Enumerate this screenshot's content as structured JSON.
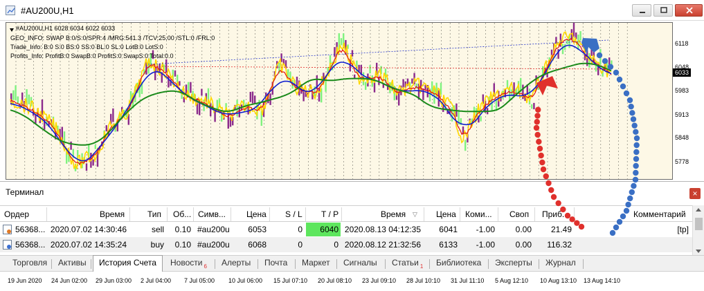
{
  "window": {
    "title": "#AU200U,H1"
  },
  "chart": {
    "info_lines": [
      "#AU200U,H1  6028 6034 6022 6033",
      "GEO_INFO: SWAP B:0/S:0/SPR:4 /MRG:541.3 /TCV:25.00 /STL:0 /FRL:0",
      "Trade_Info: B:0 S:0 BS:0 SS:0 BL:0 SL:0 LotB:0 LotS:0",
      "Profits_Info: ProfitB:0 SwapB:0 ProfitS:0 SwapS:0 Total:0.0"
    ],
    "current_price": "6033",
    "y_ticks": [
      "6118",
      "6048",
      "5983",
      "5913",
      "5848",
      "5778"
    ],
    "x_ticks": [
      "19 Jun 2020",
      "24 Jun 02:00",
      "29 Jun 03:00",
      "2 Jul 04:00",
      "7 Jul 05:00",
      "10 Jul 06:00",
      "15 Jul 07:10",
      "20 Jul 08:10",
      "23 Jul 09:10",
      "28 Jul 10:10",
      "31 Jul 11:10",
      "5 Aug 12:10",
      "10 Aug 13:10",
      "13 Aug 14:10"
    ],
    "colors": {
      "background": "#fdf8e6",
      "price": "#ffd800",
      "ma_fast": "#e01010",
      "ma_mid": "#1020d0",
      "ma_slow": "#1a8a1a",
      "bull_bar": "#7ff27f",
      "bear_bar": "#8b2a8b",
      "annotation_red": "#e0302c",
      "annotation_blue": "#3a6fc4"
    }
  },
  "terminal": {
    "title": "Терминал",
    "close_label": "×",
    "columns": [
      "Ордер",
      "Время",
      "Тип",
      "Об...",
      "Симв...",
      "Цена",
      "S / L",
      "T / P",
      "Время",
      "Цена",
      "Коми...",
      "Своп",
      "Приб...",
      "Комментарий"
    ],
    "rows": [
      {
        "order": "56368...",
        "open_time": "2020.07.02 14:30:46",
        "type": "sell",
        "volume": "0.10",
        "symbol": "#au200u",
        "open_price": "6053",
        "sl": "0",
        "tp": "6040",
        "close_time": "2020.08.13 04:12:35",
        "close_price": "6041",
        "commission": "-1.00",
        "swap": "0.00",
        "profit": "21.49",
        "comment": "[tp]"
      },
      {
        "order": "56368...",
        "open_time": "2020.07.02 14:35:24",
        "type": "buy",
        "volume": "0.10",
        "symbol": "#au200u",
        "open_price": "6068",
        "sl": "0",
        "tp": "0",
        "close_time": "2020.08.12 21:32:56",
        "close_price": "6133",
        "commission": "-1.00",
        "swap": "0.00",
        "profit": "116.32",
        "comment": ""
      }
    ],
    "tabs": [
      {
        "label": "Торговля"
      },
      {
        "label": "Активы"
      },
      {
        "label": "История Счета"
      },
      {
        "label": "Новости",
        "badge": "6"
      },
      {
        "label": "Алерты"
      },
      {
        "label": "Почта"
      },
      {
        "label": "Маркет"
      },
      {
        "label": "Сигналы"
      },
      {
        "label": "Статьи",
        "badge": "1"
      },
      {
        "label": "Библиотека"
      },
      {
        "label": "Эксперты"
      },
      {
        "label": "Журнал"
      }
    ],
    "active_tab": "История Счета"
  }
}
